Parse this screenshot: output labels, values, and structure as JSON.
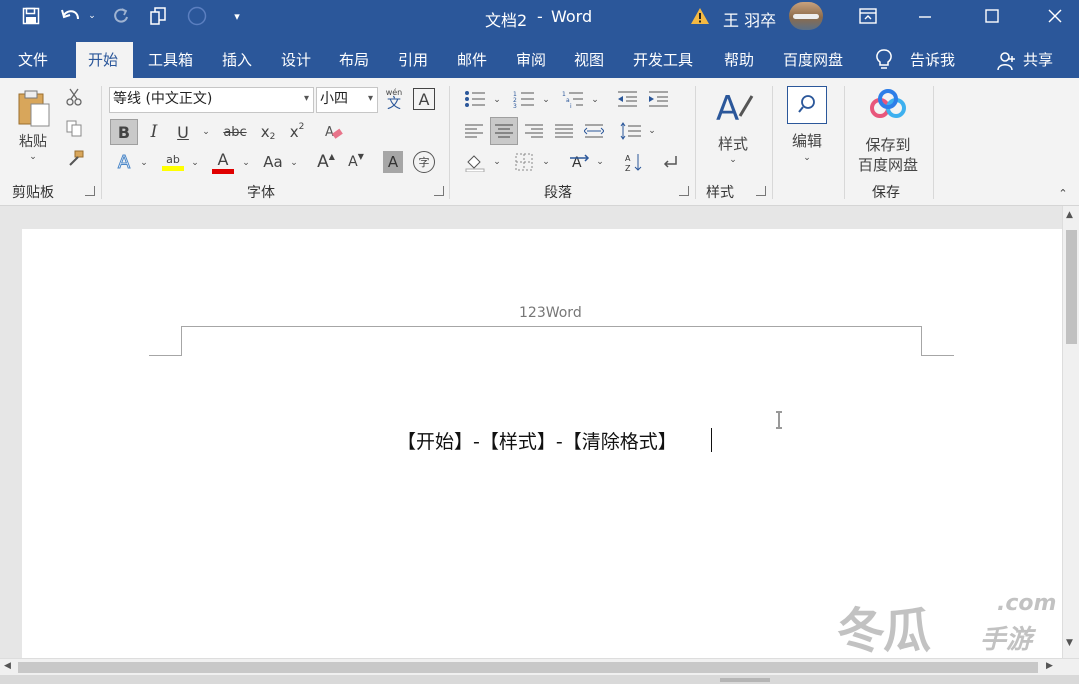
{
  "titlebar": {
    "doc_title": "文档2",
    "separator": "-",
    "app_name": "Word",
    "user_name": "王 羽卒",
    "warning_icon": "warning-icon",
    "accent": "#2b579a"
  },
  "tabs": [
    {
      "label": "文件"
    },
    {
      "label": "开始"
    },
    {
      "label": "工具箱"
    },
    {
      "label": "插入"
    },
    {
      "label": "设计"
    },
    {
      "label": "布局"
    },
    {
      "label": "引用"
    },
    {
      "label": "邮件"
    },
    {
      "label": "审阅"
    },
    {
      "label": "视图"
    },
    {
      "label": "开发工具"
    },
    {
      "label": "帮助"
    },
    {
      "label": "百度网盘"
    }
  ],
  "tell_me": "告诉我",
  "share": "共享",
  "ribbon": {
    "clipboard": {
      "paste_label": "粘贴",
      "group_label": "剪贴板"
    },
    "font": {
      "font_name": "等线 (中文正文)",
      "font_size": "小四",
      "pinyin_small": "wén",
      "pinyin_char": "文",
      "border_char": "A",
      "bold": "B",
      "italic": "I",
      "underline": "U",
      "strike": "abc",
      "sub": "x",
      "sub2": "2",
      "sup": "x",
      "sup2": "2",
      "case_label": "Aa",
      "grow": "A",
      "shrink": "A",
      "shade_char": "A",
      "enclose_char": "字",
      "effects": "A",
      "highlight_abc": "ab",
      "font_color": "A",
      "group_label": "字体"
    },
    "paragraph": {
      "group_label": "段落"
    },
    "styles": {
      "label": "样式",
      "group_label": "样式"
    },
    "editing": {
      "label": "编辑"
    },
    "save": {
      "label1": "保存到",
      "label2": "百度网盘",
      "group_label": "保存"
    }
  },
  "document": {
    "header_text": "123Word",
    "body_text": "【开始】-【样式】-【清除格式】"
  },
  "watermark": {
    "big": "冬瓜",
    "small": "手游",
    "com": ".com"
  }
}
